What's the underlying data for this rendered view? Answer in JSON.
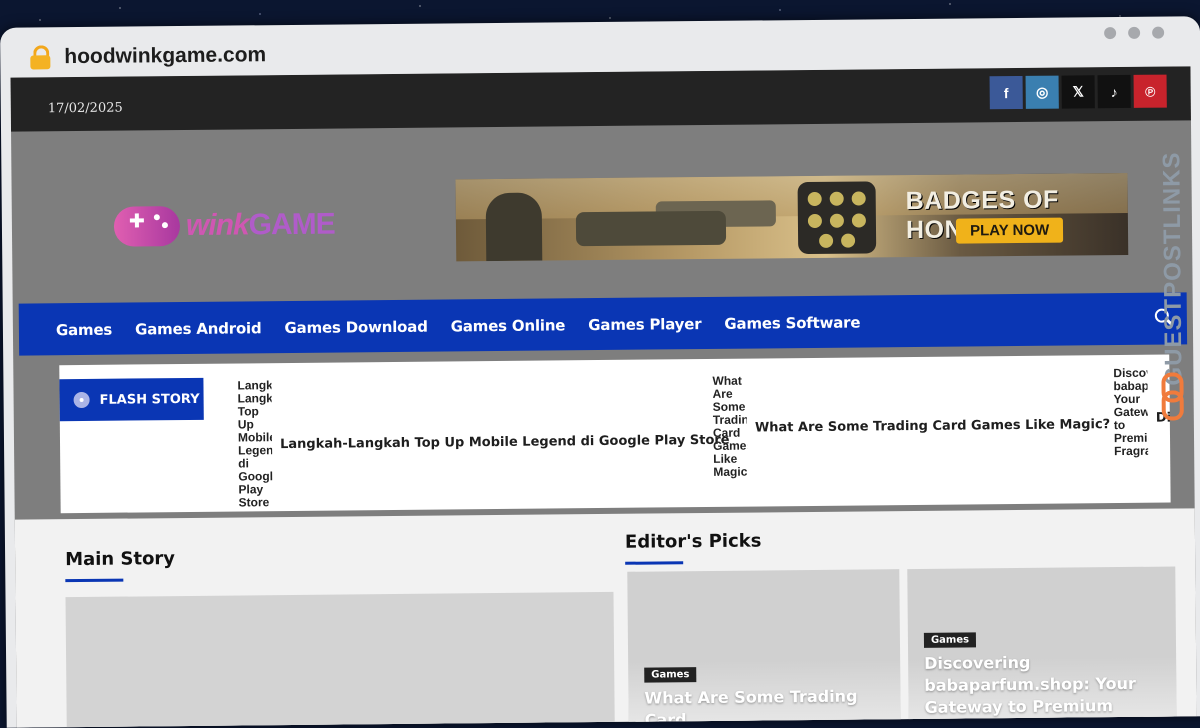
{
  "browser": {
    "url": "hoodwinkgame.com"
  },
  "topbar": {
    "date": "17/02/2025",
    "social": [
      {
        "icon": "facebook-icon",
        "glyph": "f",
        "color": "#3b5998"
      },
      {
        "icon": "instagram-icon",
        "glyph": "◎",
        "color": "#3a7fb0"
      },
      {
        "icon": "x-icon",
        "glyph": "𝕏",
        "color": "#111111"
      },
      {
        "icon": "tiktok-icon",
        "glyph": "♪",
        "color": "#111111"
      },
      {
        "icon": "pinterest-icon",
        "glyph": "℗",
        "color": "#c8232c"
      }
    ]
  },
  "logo": {
    "part1": "wink",
    "part2": "GAME"
  },
  "banner": {
    "title": "BADGES OF HONOR",
    "cta": "PLAY NOW"
  },
  "nav": {
    "items": [
      "Games",
      "Games Android",
      "Games Download",
      "Games Online",
      "Games Player",
      "Games Software"
    ]
  },
  "flash": {
    "label": "FLASH STORY",
    "items": [
      {
        "alt": "Langkah-Langkah Top Up Mobile Legend di Google Play Store",
        "title": "Langkah-Langkah Top Up Mobile Legend di Google Play Store"
      },
      {
        "alt": "What Are Some Trading Card Games Like Magic",
        "title": "What Are Some Trading Card Games Like Magic?"
      },
      {
        "alt": "Discovering babaparfum.shop: Your Gateway to Premium Fragrances",
        "title": "Di"
      }
    ]
  },
  "sections": {
    "main_story": "Main Story",
    "editors_picks": "Editor's Picks"
  },
  "cards": [
    {
      "tag": "Games",
      "title": "What Are Some Trading Card"
    },
    {
      "tag": "Games",
      "title": "Discovering babaparfum.shop: Your Gateway to Premium"
    }
  ],
  "watermark": {
    "text": "GUESTPOSTLINKS"
  },
  "colors": {
    "brand_blue": "#0a36b4",
    "topbar": "#232323",
    "header_gray": "#7e7e7e"
  }
}
